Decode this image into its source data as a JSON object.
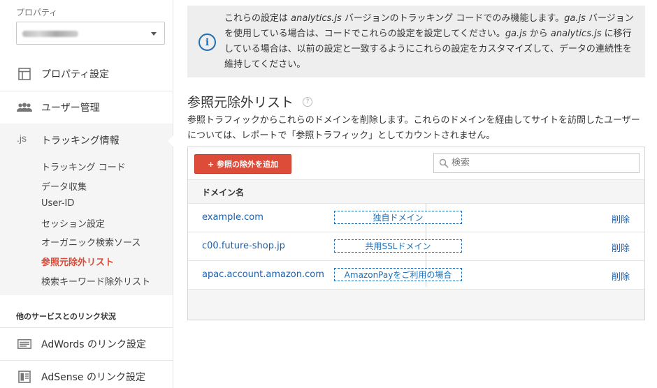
{
  "sidebar": {
    "property_label": "プロパティ",
    "nav": {
      "property_settings": "プロパティ設定",
      "user_management": "ユーザー管理",
      "tracking_info_icon": ".js",
      "tracking_info": "トラッキング情報"
    },
    "tracking_sub": [
      "トラッキング コード",
      "データ収集",
      "User-ID",
      "セッション設定",
      "オーガニック検索ソース",
      "参照元除外リスト",
      "検索キーワード除外リスト"
    ],
    "active_sub_index": 5,
    "linked_services_header": "他のサービスとのリンク状況",
    "linked": {
      "adwords": "AdWords のリンク設定",
      "adsense": "AdSense のリンク設定"
    }
  },
  "info": {
    "line1_a": "これらの設定は ",
    "line1_b": "analytics.js",
    "line1_c": " バージョンのトラッキング コードでのみ機能します。",
    "line1_d": "ga.js",
    "line1_e": " バージョンを使用している場合は、コードでこれらの設定を設定してください。",
    "line1_f": "ga.js",
    "line1_g": " から ",
    "line1_h": "analytics.js",
    "line1_i": " に移行している場合は、以前の設定と一致するようにこれらの設定をカスタマイズして、データの連続性を維持してください。"
  },
  "main": {
    "title": "参照元除外リスト",
    "help": "?",
    "description": "参照トラフィックからこれらのドメインを削除します。これらのドメインを経由してサイトを訪問したユーザーについては、レポートで「参照トラフィック」としてカウントされません。",
    "add_button": "+ 参照の除外を追加",
    "search_placeholder": "検索",
    "column_header": "ドメイン名",
    "rows": [
      {
        "domain": "example.com",
        "tag": "独自ドメイン",
        "action": "削除"
      },
      {
        "domain": "c00.future-shop.jp",
        "tag": "共用SSLドメイン",
        "action": "削除"
      },
      {
        "domain": "apac.account.amazon.com",
        "tag": "AmazonPayをご利用の場合",
        "action": "削除"
      }
    ]
  },
  "colors": {
    "accent_red": "#dd4b39",
    "link_blue": "#1d5fa8",
    "info_blue": "#1d70b7"
  }
}
